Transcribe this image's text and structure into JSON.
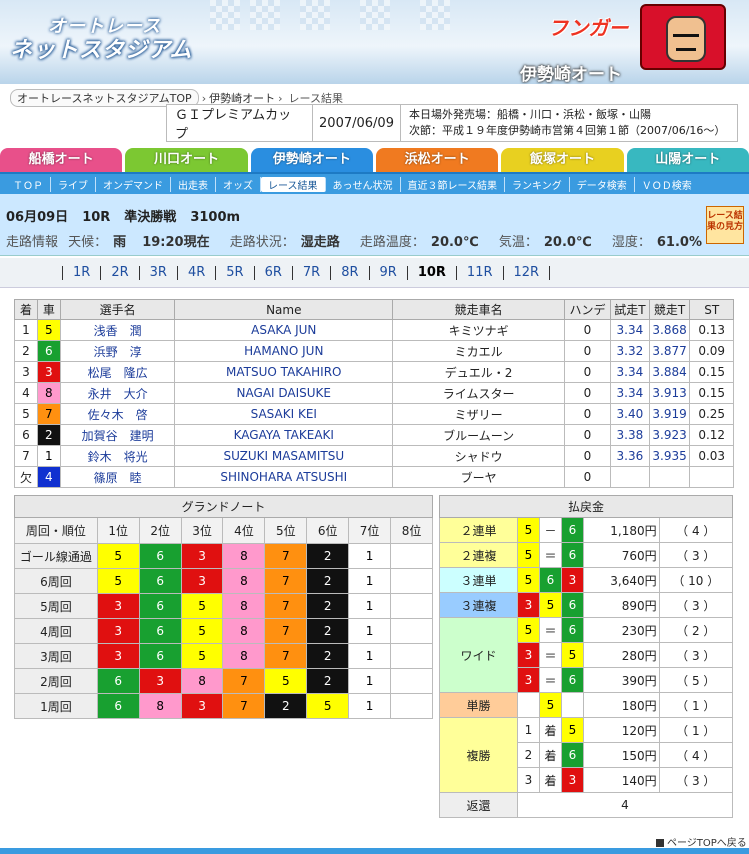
{
  "header": {
    "logo_line1": "オートレース",
    "logo_line2": "ネットスタジアム",
    "mascot_text": "フンガー",
    "venue_title": "伊勢崎オート"
  },
  "breadcrumb": {
    "items": [
      "オートレースネットスタジアムTOP",
      "伊勢崎オート",
      "レース結果"
    ],
    "sep": "›"
  },
  "race_info": {
    "gp": "ＧＩプレミアムカップ",
    "date": "2007/06/09",
    "note1": "本日場外発売場：船橋・川口・浜松・飯塚・山陽",
    "note2": "次節：平成１９年度伊勢崎市営第４回第１節（2007/06/16～）"
  },
  "venue_tabs": [
    {
      "label": "船橋オート",
      "color": "#e8508a"
    },
    {
      "label": "川口オート",
      "color": "#7cc832"
    },
    {
      "label": "伊勢崎オート",
      "color": "#2a8ee0"
    },
    {
      "label": "浜松オート",
      "color": "#f07a20"
    },
    {
      "label": "飯塚オート",
      "color": "#e8d020"
    },
    {
      "label": "山陽オート",
      "color": "#38b8c0"
    }
  ],
  "subnav": [
    "ＴＯＰ",
    "ライブ",
    "オンデマンド",
    "出走表",
    "オッズ",
    "レース結果",
    "あっせん状況",
    "直近３節レース結果",
    "ランキング",
    "データ検索",
    "ＶＯＤ検索"
  ],
  "race_bar": {
    "date": "06月09日",
    "race_no": "10R",
    "race_name": "準決勝戦",
    "distance": "3100m",
    "info_label": "走路情報",
    "weather_label": "天候：",
    "weather": "雨",
    "time": "19:20現在",
    "track_label": "走路状況：",
    "track": "湿走路",
    "track_temp_label": "走路温度：",
    "track_temp": "20.0℃",
    "temp_label": "気温：",
    "temp": "20.0℃",
    "humidity_label": "湿度：",
    "humidity": "61.0%",
    "result_button": "レース結果の見方"
  },
  "race_nav": [
    "1R",
    "2R",
    "3R",
    "4R",
    "5R",
    "6R",
    "7R",
    "8R",
    "9R",
    "10R",
    "11R",
    "12R"
  ],
  "entries": {
    "headers": [
      "着",
      "車",
      "選手名",
      "Name",
      "競走車名",
      "ハンデ",
      "試走T",
      "競走T",
      "ST"
    ],
    "rows": [
      {
        "pos": "1",
        "car": "5",
        "name": "浅香　潤",
        "en": "ASAKA JUN",
        "bike": "キミツナギ",
        "handi": "0",
        "trial": "3.34",
        "race": "3.868",
        "st": "0.13"
      },
      {
        "pos": "2",
        "car": "6",
        "name": "浜野　淳",
        "en": "HAMANO JUN",
        "bike": "ミカエル",
        "handi": "0",
        "trial": "3.32",
        "race": "3.877",
        "st": "0.09"
      },
      {
        "pos": "3",
        "car": "3",
        "name": "松尾　隆広",
        "en": "MATSUO TAKAHIRO",
        "bike": "デュエル・2",
        "handi": "0",
        "trial": "3.34",
        "race": "3.884",
        "st": "0.15"
      },
      {
        "pos": "4",
        "car": "8",
        "name": "永井　大介",
        "en": "NAGAI DAISUKE",
        "bike": "ライムスター",
        "handi": "0",
        "trial": "3.34",
        "race": "3.913",
        "st": "0.15"
      },
      {
        "pos": "5",
        "car": "7",
        "name": "佐々木　啓",
        "en": "SASAKI KEI",
        "bike": "ミザリー",
        "handi": "0",
        "trial": "3.40",
        "race": "3.919",
        "st": "0.25"
      },
      {
        "pos": "6",
        "car": "2",
        "name": "加賀谷　建明",
        "en": "KAGAYA TAKEAKI",
        "bike": "ブルームーン",
        "handi": "0",
        "trial": "3.38",
        "race": "3.923",
        "st": "0.12"
      },
      {
        "pos": "7",
        "car": "1",
        "name": "鈴木　将光",
        "en": "SUZUKI MASAMITSU",
        "bike": "シャドウ",
        "handi": "0",
        "trial": "3.36",
        "race": "3.935",
        "st": "0.03"
      },
      {
        "pos": "欠",
        "car": "4",
        "name": "篠原　睦",
        "en": "SHINOHARA ATSUSHI",
        "bike": "ブーヤ",
        "handi": "0",
        "trial": "",
        "race": "",
        "st": ""
      }
    ]
  },
  "grand_note": {
    "title": "グランドノート",
    "headers": [
      "周回・順位",
      "1位",
      "2位",
      "3位",
      "4位",
      "5位",
      "6位",
      "7位",
      "8位"
    ],
    "rows": [
      {
        "label": "ゴール線通過",
        "cars": [
          "5",
          "6",
          "3",
          "8",
          "7",
          "2",
          "1",
          ""
        ]
      },
      {
        "label": "6周回",
        "cars": [
          "5",
          "6",
          "3",
          "8",
          "7",
          "2",
          "1",
          ""
        ]
      },
      {
        "label": "5周回",
        "cars": [
          "3",
          "6",
          "5",
          "8",
          "7",
          "2",
          "1",
          ""
        ]
      },
      {
        "label": "4周回",
        "cars": [
          "3",
          "6",
          "5",
          "8",
          "7",
          "2",
          "1",
          ""
        ]
      },
      {
        "label": "3周回",
        "cars": [
          "3",
          "6",
          "5",
          "8",
          "7",
          "2",
          "1",
          ""
        ]
      },
      {
        "label": "2周回",
        "cars": [
          "6",
          "3",
          "8",
          "7",
          "5",
          "2",
          "1",
          ""
        ]
      },
      {
        "label": "1周回",
        "cars": [
          "6",
          "8",
          "3",
          "7",
          "2",
          "5",
          "1",
          ""
        ]
      }
    ]
  },
  "payout": {
    "title": "払戻金",
    "rows": [
      {
        "type": "２連単",
        "c1": "5",
        "sep": "－",
        "c2": "6",
        "c3": "",
        "amount": "1,180円",
        "pop": "（ 4 ）"
      },
      {
        "type": "２連複",
        "c1": "5",
        "sep": "＝",
        "c2": "6",
        "c3": "",
        "amount": "760円",
        "pop": "（ 3 ）"
      },
      {
        "type": "３連単",
        "c1": "5",
        "sep": "6",
        "c2": "3",
        "c3": "",
        "amount": "3,640円",
        "pop": "（ 10 ）"
      },
      {
        "type": "３連複",
        "c1": "3",
        "sep": "5",
        "c2": "6",
        "c3": "",
        "amount": "890円",
        "pop": "（ 3 ）"
      },
      {
        "type": "ワイド",
        "c1": "5",
        "sep": "＝",
        "c2": "6",
        "c3": "",
        "amount": "230円",
        "pop": "（ 2 ）"
      },
      {
        "type": "",
        "c1": "3",
        "sep": "＝",
        "c2": "5",
        "c3": "",
        "amount": "280円",
        "pop": "（ 3 ）"
      },
      {
        "type": "",
        "c1": "3",
        "sep": "＝",
        "c2": "6",
        "c3": "",
        "amount": "390円",
        "pop": "（ 5 ）"
      },
      {
        "type": "単勝",
        "c1": "",
        "sep": "5",
        "c2": "",
        "c3": "",
        "amount": "180円",
        "pop": "（ 1 ）"
      },
      {
        "type": "複勝",
        "c1": "1",
        "sep": "着",
        "c2": "5",
        "c3": "",
        "amount": "120円",
        "pop": "（ 1 ）"
      },
      {
        "type": "",
        "c1": "2",
        "sep": "着",
        "c2": "6",
        "c3": "",
        "amount": "150円",
        "pop": "（ 4 ）"
      },
      {
        "type": "",
        "c1": "3",
        "sep": "着",
        "c2": "3",
        "c3": "",
        "amount": "140円",
        "pop": "（ 3 ）"
      },
      {
        "type": "返還",
        "c1": "",
        "sep": "4",
        "c2": "",
        "c3": "",
        "amount": "",
        "pop": ""
      }
    ]
  },
  "footer": {
    "page_top": "ページTOPへ戻る"
  }
}
